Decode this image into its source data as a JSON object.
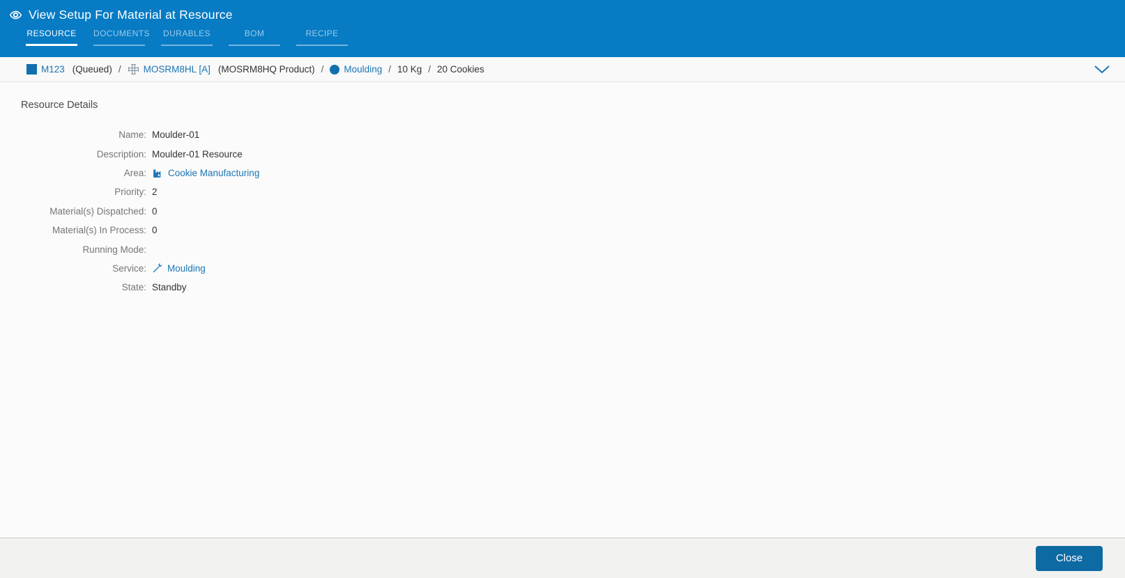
{
  "header": {
    "title": "View Setup For Material at Resource",
    "tabs": [
      {
        "label": "RESOURCE",
        "active": true
      },
      {
        "label": "DOCUMENTS",
        "active": false
      },
      {
        "label": "DURABLES",
        "active": false
      },
      {
        "label": "BOM",
        "active": false
      },
      {
        "label": "RECIPE",
        "active": false
      }
    ]
  },
  "breadcrumb": {
    "separator": "/",
    "material_name": "M123",
    "material_state": "(Queued)",
    "flow_name": "MOSRM8HL [A]",
    "flow_product": "(MOSRM8HQ Product)",
    "step_name": "Moulding",
    "primary_quantity": "10 Kg",
    "secondary_quantity": "20 Cookies",
    "icons": {
      "material": "material-square-icon",
      "flow": "flow-junction-icon",
      "step": "step-circle-icon",
      "expand": "chevron-down-icon"
    }
  },
  "main": {
    "section_title": "Resource Details",
    "fields": [
      {
        "label": "Name:",
        "value": "Moulder-01"
      },
      {
        "label": "Description:",
        "value": "Moulder-01 Resource"
      },
      {
        "label": "Area:",
        "value": "Cookie Manufacturing",
        "link": true,
        "icon": "factory-icon"
      },
      {
        "label": "Priority:",
        "value": "2"
      },
      {
        "label": "Material(s) Dispatched:",
        "value": "0"
      },
      {
        "label": "Material(s) In Process:",
        "value": "0"
      },
      {
        "label": "Running Mode:",
        "value": ""
      },
      {
        "label": "Service:",
        "value": "Moulding",
        "link": true,
        "icon": "service-wrench-icon"
      },
      {
        "label": "State:",
        "value": "Standby"
      }
    ]
  },
  "footer": {
    "close_label": "Close"
  },
  "colors": {
    "header_bg": "#077bc4",
    "active_tab": "#ffffff",
    "inactive_tab": "#9ecbe9",
    "link": "#1b76b4",
    "icon_blue": "#1170ad",
    "close_button_bg": "#0e6aa2",
    "breadcrumb_bg": "#f9f9f9",
    "footer_bg": "#f2f2f0",
    "label_text": "#757575",
    "value_text": "#333333"
  }
}
